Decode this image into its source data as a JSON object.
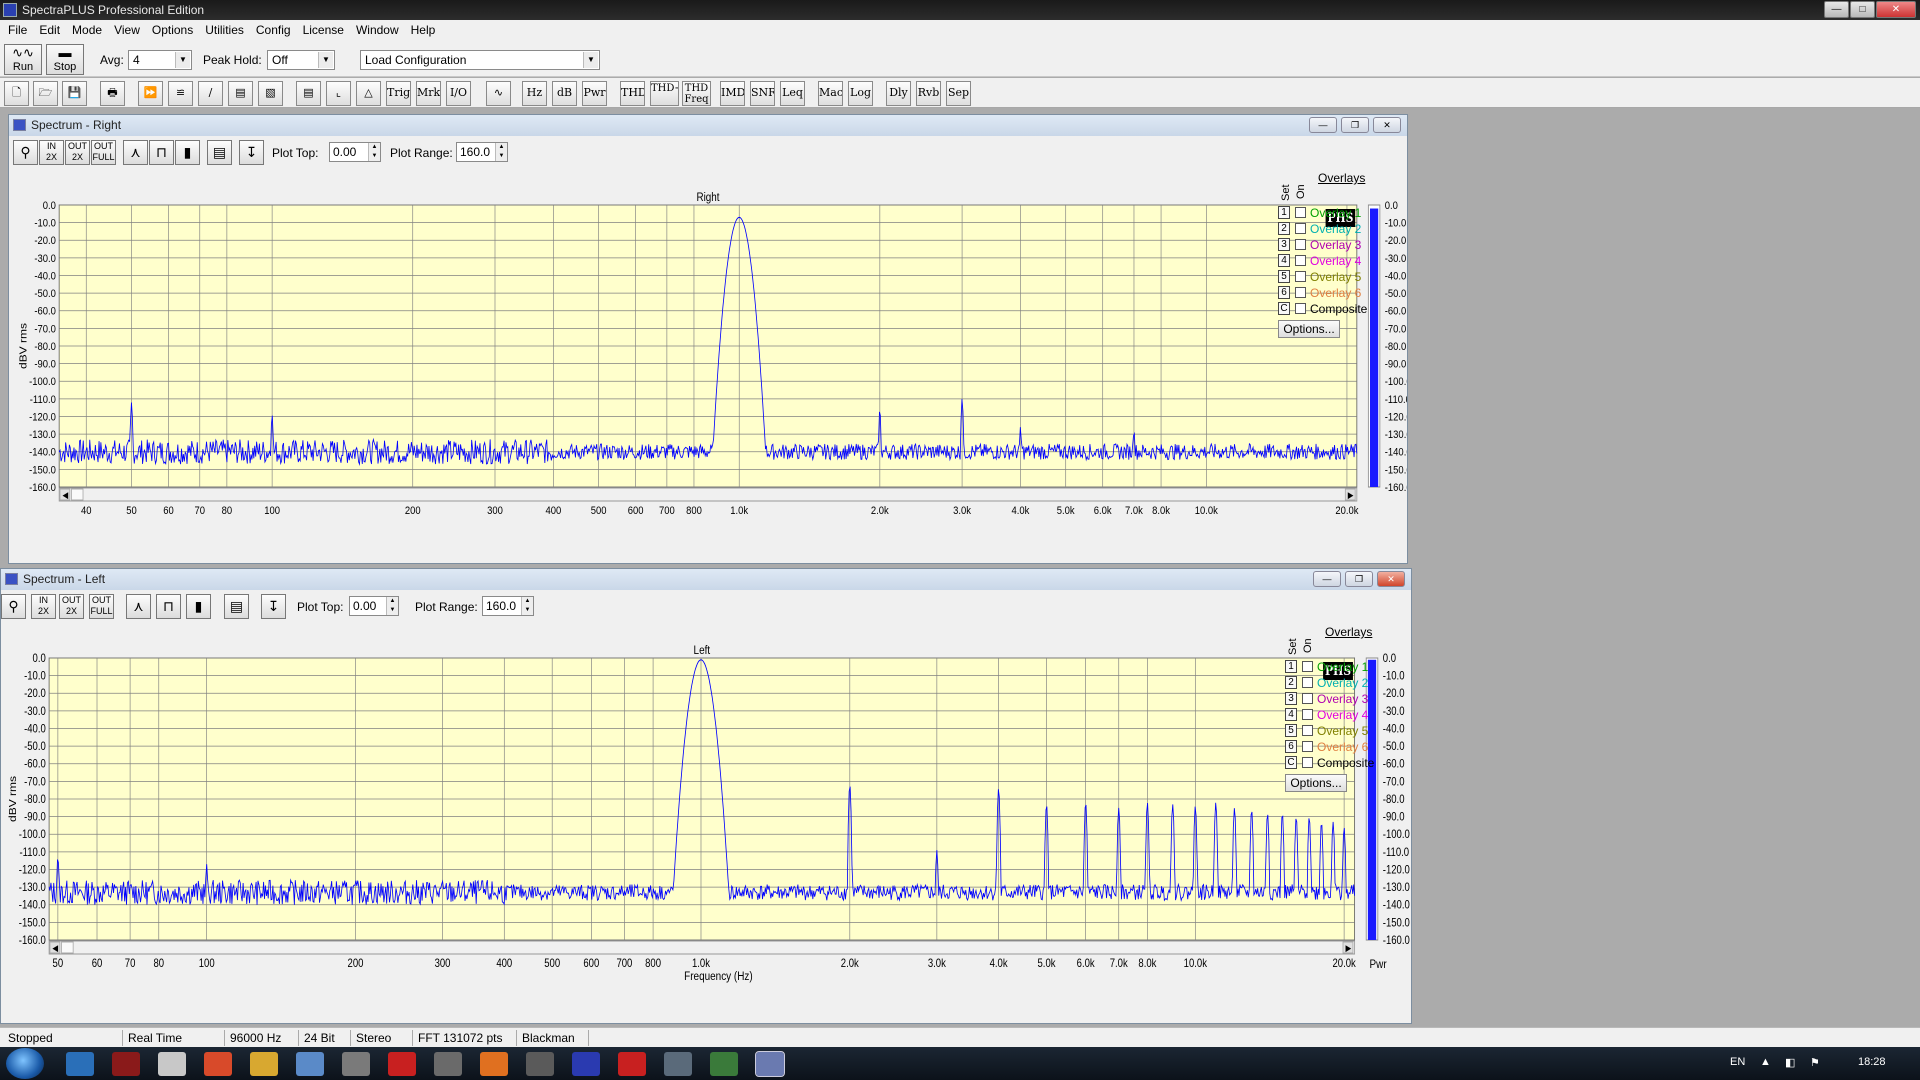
{
  "window": {
    "title": "SpectraPLUS Professional Edition"
  },
  "menu": [
    "File",
    "Edit",
    "Mode",
    "View",
    "Options",
    "Utilities",
    "Config",
    "License",
    "Window",
    "Help"
  ],
  "toolbar": {
    "run_label": "Run",
    "stop_label": "Stop",
    "avg_label": "Avg:",
    "avg_value": "4",
    "peak_hold_label": "Peak Hold:",
    "peak_hold_value": "Off",
    "load_config_value": "Load Configuration"
  },
  "toolbar2_buttons": [
    "Trig",
    "Mrk",
    "I/O",
    "Hz",
    "dB",
    "Pwr",
    "THD",
    "THD+N",
    "THD Freq",
    "IMD",
    "SNR",
    "Leq",
    "Mac",
    "Log",
    "Dly",
    "Rvb",
    "Sep"
  ],
  "colors": {
    "plot_bg": "#ffffcc",
    "trace": "#0000ff",
    "grid": "#808080",
    "overlay_1": "#00a000",
    "overlay_2": "#00b0b0",
    "overlay_3": "#b000b0",
    "overlay_4": "#e000e0",
    "overlay_5": "#808000",
    "overlay_6": "#e08040"
  },
  "panel_controls": {
    "plot_top_label": "Plot Top:",
    "plot_top_value": "0.00",
    "plot_range_label": "Plot Range:",
    "plot_range_value": "160.0",
    "logo": "PHS"
  },
  "overlays": {
    "header": "Overlays",
    "set_label": "Set",
    "on_label": "On",
    "options_label": "Options...",
    "items": [
      {
        "num": "1",
        "label": "Overlay 1"
      },
      {
        "num": "2",
        "label": "Overlay 2"
      },
      {
        "num": "3",
        "label": "Overlay 3"
      },
      {
        "num": "4",
        "label": "Overlay 4"
      },
      {
        "num": "5",
        "label": "Overlay 5"
      },
      {
        "num": "6",
        "label": "Overlay 6"
      },
      {
        "num": "C",
        "label": "Composite"
      }
    ]
  },
  "panels": {
    "right": {
      "title": "Spectrum - Right",
      "plot_title": "Right"
    },
    "left": {
      "title": "Spectrum - Left",
      "plot_title": "Left",
      "xlabel": "Frequency (Hz)",
      "meter_label": "Pwr"
    }
  },
  "status": {
    "state": "Stopped",
    "mode": "Real Time",
    "rate": "96000 Hz",
    "bits": "24 Bit",
    "channels": "Stereo",
    "fft": "FFT 131072 pts",
    "window": "Blackman"
  },
  "tray": {
    "lang": "EN",
    "clock": "18:28"
  },
  "chart_data": [
    {
      "type": "line",
      "title": "Right",
      "ylabel": "dBV rms",
      "x_scale": "log",
      "xlim": [
        35,
        21000
      ],
      "ylim": [
        -160,
        0
      ],
      "y_ticks": [
        "0.0",
        "-10.0",
        "-20.0",
        "-30.0",
        "-40.0",
        "-50.0",
        "-60.0",
        "-70.0",
        "-80.0",
        "-90.0",
        "-100.0",
        "-110.0",
        "-120.0",
        "-130.0",
        "-140.0",
        "-150.0",
        "-160.0"
      ],
      "x_ticks": [
        "40",
        "50",
        "60",
        "70",
        "80",
        "100",
        "200",
        "300",
        "400",
        "500",
        "600",
        "700",
        "800",
        "1.0k",
        "2.0k",
        "3.0k",
        "4.0k",
        "5.0k",
        "6.0k",
        "7.0k",
        "8.0k",
        "10.0k",
        "20.0k"
      ],
      "x_tick_values": [
        40,
        50,
        60,
        70,
        80,
        100,
        200,
        300,
        400,
        500,
        600,
        700,
        800,
        1000,
        2000,
        3000,
        4000,
        5000,
        6000,
        7000,
        8000,
        10000,
        20000
      ],
      "noise_floor": -140,
      "peaks": [
        {
          "x": 50,
          "y": -112
        },
        {
          "x": 100,
          "y": -119
        },
        {
          "x": 1000,
          "y": -7
        },
        {
          "x": 2000,
          "y": -116
        },
        {
          "x": 3000,
          "y": -110
        },
        {
          "x": 4000,
          "y": -126
        },
        {
          "x": 7000,
          "y": -128
        }
      ],
      "series": [
        {
          "values_note": ""
        }
      ]
    },
    {
      "type": "line",
      "title": "Left",
      "xlabel": "Frequency (Hz)",
      "ylabel": "dBV rms",
      "x_scale": "log",
      "xlim": [
        48,
        21000
      ],
      "ylim": [
        -160,
        0
      ],
      "y_ticks": [
        "0.0",
        "-10.0",
        "-20.0",
        "-30.0",
        "-40.0",
        "-50.0",
        "-60.0",
        "-70.0",
        "-80.0",
        "-90.0",
        "-100.0",
        "-110.0",
        "-120.0",
        "-130.0",
        "-140.0",
        "-150.0",
        "-160.0"
      ],
      "x_ticks": [
        "50",
        "60",
        "70",
        "80",
        "100",
        "200",
        "300",
        "400",
        "500",
        "600",
        "700",
        "800",
        "1.0k",
        "2.0k",
        "3.0k",
        "4.0k",
        "5.0k",
        "6.0k",
        "7.0k",
        "8.0k",
        "10.0k",
        "20.0k"
      ],
      "x_tick_values": [
        50,
        60,
        70,
        80,
        100,
        200,
        300,
        400,
        500,
        600,
        700,
        800,
        1000,
        2000,
        3000,
        4000,
        5000,
        6000,
        7000,
        8000,
        10000,
        20000
      ],
      "noise_floor": -133,
      "peaks": [
        {
          "x": 50,
          "y": -113
        },
        {
          "x": 100,
          "y": -117
        },
        {
          "x": 1000,
          "y": -1
        },
        {
          "x": 2000,
          "y": -72
        },
        {
          "x": 3000,
          "y": -109
        },
        {
          "x": 4000,
          "y": -74
        },
        {
          "x": 5000,
          "y": -83
        },
        {
          "x": 6000,
          "y": -82
        },
        {
          "x": 7000,
          "y": -85
        },
        {
          "x": 8000,
          "y": -82
        },
        {
          "x": 9000,
          "y": -83
        },
        {
          "x": 10000,
          "y": -84
        },
        {
          "x": 11000,
          "y": -82
        },
        {
          "x": 12000,
          "y": -85
        },
        {
          "x": 13000,
          "y": -86
        },
        {
          "x": 14000,
          "y": -88
        },
        {
          "x": 15000,
          "y": -88
        },
        {
          "x": 16000,
          "y": -90
        },
        {
          "x": 17000,
          "y": -90
        },
        {
          "x": 18000,
          "y": -93
        },
        {
          "x": 19000,
          "y": -93
        },
        {
          "x": 20000,
          "y": -96
        }
      ]
    }
  ]
}
